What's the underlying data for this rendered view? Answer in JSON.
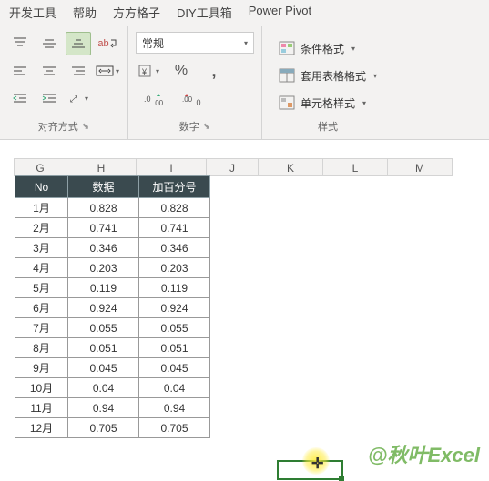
{
  "tabs": {
    "dev": "开发工具",
    "help": "帮助",
    "ff": "方方格子",
    "diy": "DIY工具箱",
    "pp": "Power Pivot"
  },
  "ribbon": {
    "align_label": "对齐方式",
    "num_label": "数字",
    "num_format": "常规",
    "pct": "%",
    "comma": ",",
    "styles_label": "样式",
    "cond_fmt": "条件格式",
    "table_fmt": "套用表格格式",
    "cell_style": "单元格样式",
    "wrap": "ab"
  },
  "col_headers": {
    "G": "G",
    "H": "H",
    "I": "I",
    "J": "J",
    "K": "K",
    "L": "L",
    "M": "M"
  },
  "table": {
    "headers": {
      "no": "No",
      "data": "数据",
      "pct": "加百分号"
    },
    "rows": [
      {
        "no": "1月",
        "data": "0.828",
        "pct": "0.828"
      },
      {
        "no": "2月",
        "data": "0.741",
        "pct": "0.741"
      },
      {
        "no": "3月",
        "data": "0.346",
        "pct": "0.346"
      },
      {
        "no": "4月",
        "data": "0.203",
        "pct": "0.203"
      },
      {
        "no": "5月",
        "data": "0.119",
        "pct": "0.119"
      },
      {
        "no": "6月",
        "data": "0.924",
        "pct": "0.924"
      },
      {
        "no": "7月",
        "data": "0.055",
        "pct": "0.055"
      },
      {
        "no": "8月",
        "data": "0.051",
        "pct": "0.051"
      },
      {
        "no": "9月",
        "data": "0.045",
        "pct": "0.045"
      },
      {
        "no": "10月",
        "data": "0.04",
        "pct": "0.04"
      },
      {
        "no": "11月",
        "data": "0.94",
        "pct": "0.94"
      },
      {
        "no": "12月",
        "data": "0.705",
        "pct": "0.705"
      }
    ]
  },
  "watermark": "@秋叶Excel",
  "chart_data": {
    "type": "table",
    "title": "",
    "headers": [
      "No",
      "数据",
      "加百分号"
    ],
    "rows": [
      [
        "1月",
        0.828,
        0.828
      ],
      [
        "2月",
        0.741,
        0.741
      ],
      [
        "3月",
        0.346,
        0.346
      ],
      [
        "4月",
        0.203,
        0.203
      ],
      [
        "5月",
        0.119,
        0.119
      ],
      [
        "6月",
        0.924,
        0.924
      ],
      [
        "7月",
        0.055,
        0.055
      ],
      [
        "8月",
        0.051,
        0.051
      ],
      [
        "9月",
        0.045,
        0.045
      ],
      [
        "10月",
        0.04,
        0.04
      ],
      [
        "11月",
        0.94,
        0.94
      ],
      [
        "12月",
        0.705,
        0.705
      ]
    ]
  }
}
